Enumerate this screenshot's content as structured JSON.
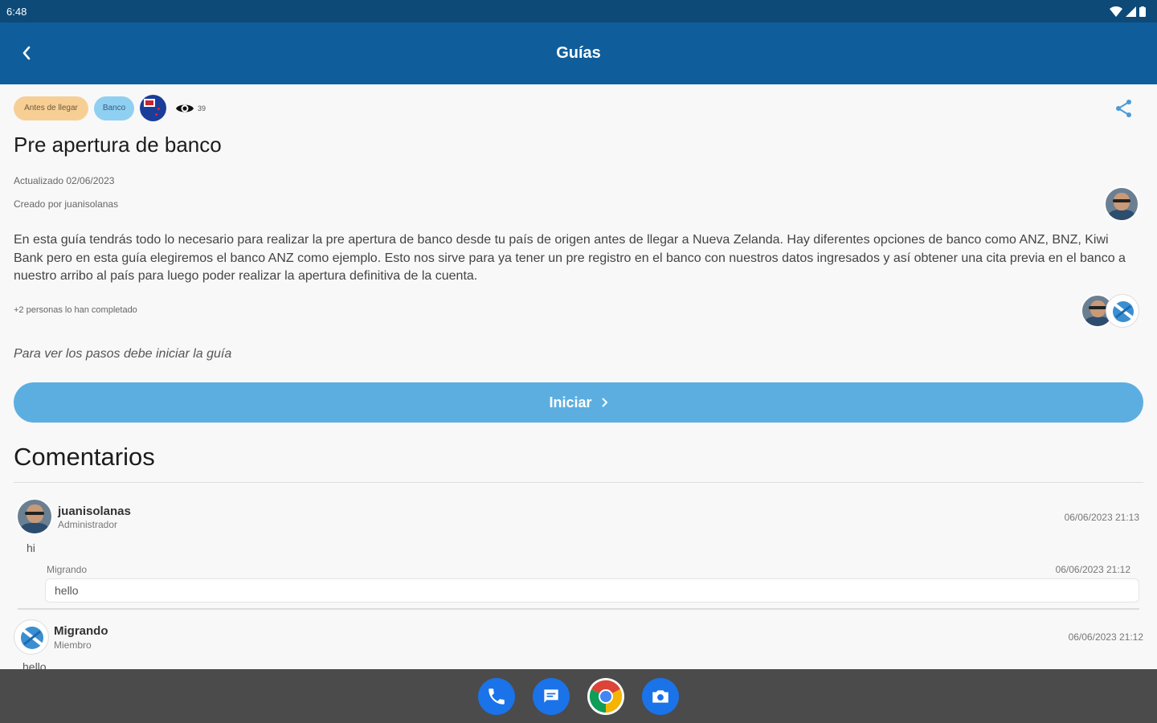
{
  "status": {
    "time": "6:48"
  },
  "appbar": {
    "title": "Guías"
  },
  "guide": {
    "chips": [
      "Antes de llegar",
      "Banco"
    ],
    "views": "39",
    "title": "Pre apertura de banco",
    "updated": "Actualizado 02/06/2023",
    "created_by": "Creado por juanisolanas",
    "description": "En esta guía tendrás todo lo necesario para realizar la pre apertura de banco desde tu país de origen antes de llegar a Nueva Zelanda. Hay diferentes opciones de banco como ANZ, BNZ, Kiwi Bank pero en esta guía elegiremos el banco ANZ como ejemplo. Esto nos sirve para ya tener un pre registro en el banco con nuestros datos ingresados y así obtener una cita previa en el banco a nuestro arribo al país para luego poder realizar la apertura definitiva de la cuenta.",
    "completed_text": "+2 personas lo han completado",
    "note": "Para ver los pasos debe iniciar la guía",
    "start_button": "Iniciar"
  },
  "comments": {
    "heading": "Comentarios",
    "items": [
      {
        "author": "juanisolanas",
        "role": "Administrador",
        "time": "06/06/2023 21:13",
        "text": "hi",
        "reply": {
          "author": "Migrando",
          "time": "06/06/2023 21:12",
          "text": "hello"
        }
      },
      {
        "author": "Migrando",
        "role": "Miembro",
        "time": "06/06/2023 21:12",
        "text": "hello"
      }
    ]
  },
  "colors": {
    "appbar": "#0f5e9b",
    "statusbar": "#0d4a78",
    "button": "#5caee0",
    "chip_orange": "#f7cf95",
    "chip_blue": "#8fd0f2"
  },
  "dock": [
    "phone-icon",
    "messages-icon",
    "chrome-icon",
    "camera-icon"
  ]
}
